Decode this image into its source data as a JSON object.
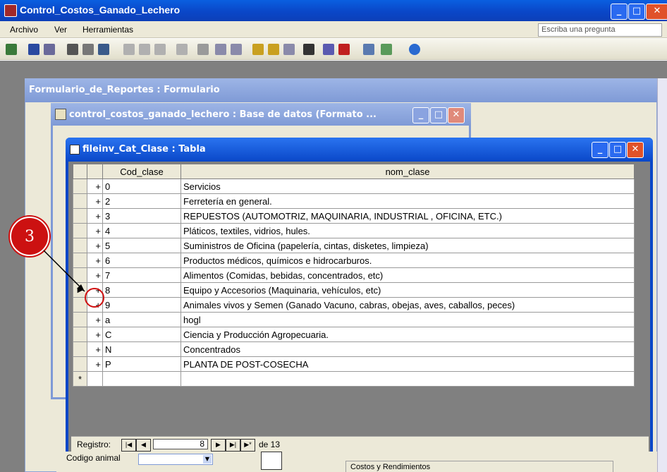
{
  "app": {
    "title": "Control_Costos_Ganado_Lechero"
  },
  "menu": {
    "items": [
      "Archivo",
      "Ver",
      "Herramientas"
    ],
    "ask_placeholder": "Escriba una pregunta"
  },
  "form_window": {
    "title": "Formulario_de_Reportes : Formulario"
  },
  "db_window": {
    "title": "control_costos_ganado_lechero : Base de datos (Formato ..."
  },
  "table_window": {
    "title": "fileinv_Cat_Clase : Tabla",
    "columns": [
      "Cod_clase",
      "nom_clase"
    ],
    "rows": [
      {
        "cod": "0",
        "nom": "Servicios"
      },
      {
        "cod": "2",
        "nom": "Ferretería en general."
      },
      {
        "cod": "3",
        "nom": "REPUESTOS (AUTOMOTRIZ, MAQUINARIA, INDUSTRIAL , OFICINA, ETC.)"
      },
      {
        "cod": "4",
        "nom": "Pláticos, textiles, vidrios, hules."
      },
      {
        "cod": "5",
        "nom": "Suministros de Oficina (papelería, cintas, disketes, limpieza)"
      },
      {
        "cod": "6",
        "nom": "Productos médicos, químicos e hidrocarburos."
      },
      {
        "cod": "7",
        "nom": "Alimentos (Comidas, bebidas, concentrados, etc)"
      },
      {
        "cod": "8",
        "nom": "Equipo y Accesorios (Maquinaria, vehículos, etc)"
      },
      {
        "cod": "9",
        "nom": "Animales vivos y Semen (Ganado Vacuno, cabras, obejas, aves, caballos, peces)"
      },
      {
        "cod": "a",
        "nom": "hogl"
      },
      {
        "cod": "C",
        "nom": "Ciencia y Producción Agropecuaria."
      },
      {
        "cod": "N",
        "nom": "Concentrados"
      },
      {
        "cod": "P",
        "nom": "PLANTA DE POST-COSECHA"
      }
    ],
    "current_row_index": 7,
    "expand_glyph": "+",
    "new_row_glyph": "*",
    "selector_glyph": "▶"
  },
  "navigation": {
    "label": "Registro:",
    "current": "8",
    "total_text": "de 13"
  },
  "form_fields": {
    "codigo_animal_label": "Codigo animal",
    "costos_label": "Costos y Rendimientos"
  },
  "callout": {
    "number": "3"
  },
  "colors": {
    "title_blue": "#0a47c8",
    "inactive_blue": "#7f9ad6",
    "callout_red": "#cc1111"
  }
}
